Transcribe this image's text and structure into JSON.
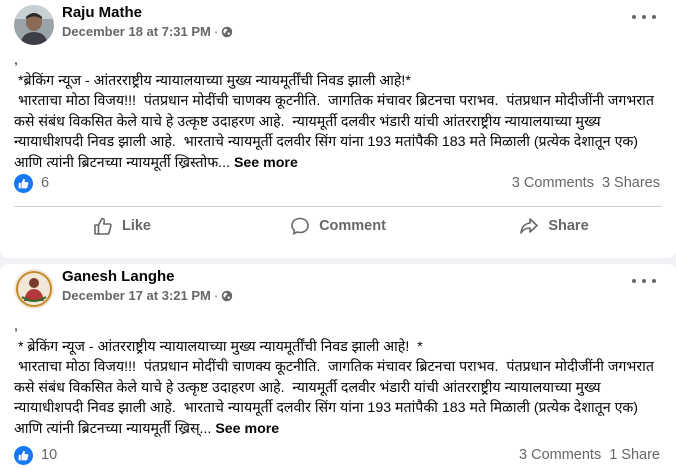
{
  "post1": {
    "author": "Raju Mathe",
    "timestamp": "December 18 at 7:31 PM",
    "separator": "·",
    "lead": ",",
    "text": " *ब्रेकिंग न्यूज - आंतरराष्ट्रीय न्यायालयाच्या मुख्य न्यायमूर्तींची निवड झाली आहे!*\n भारताचा मोठा विजय!!!  पंतप्रधान मोदींची चाणक्य कूटनीति.  जागतिक मंचावर ब्रिटनचा पराभव.  पंतप्रधान मोदीजींनी जगभरात कसे संबंध विकसित केले याचे हे उत्कृष्ट उदाहरण आहे.  न्यायमूर्ती दलवीर भंडारी यांची आंतरराष्ट्रीय न्यायालयाच्या मुख्य न्यायाधीशपदी निवड झाली आहे.  भारताचे न्यायमूर्ती दलवीर सिंग यांना 193 मतांपैकी 183 मते मिळाली (प्रत्येक देशातून एक) आणि त्यांनी ब्रिटनच्या न्यायमूर्ती ख्रिस्तोफ...",
    "see_more": "See more",
    "likes": "6",
    "comments": "3 Comments",
    "shares": "3 Shares",
    "actions": {
      "like": "Like",
      "comment": "Comment",
      "share": "Share"
    }
  },
  "post2": {
    "author": "Ganesh Langhe",
    "timestamp": "December 17 at 3:21 PM",
    "separator": "·",
    "lead": ",",
    "text": " * ब्रेकिंग न्यूज - आंतरराष्ट्रीय न्यायालयाच्या मुख्य न्यायमूर्तींची निवड झाली आहे!  *\n भारताचा मोठा विजय!!!  पंतप्रधान मोदींची चाणक्य कूटनीति.  जागतिक मंचावर ब्रिटनचा पराभव.  पंतप्रधान मोदीजींनी जगभरात कसे संबंध विकसित केले याचे हे उत्कृष्ट उदाहरण आहे.  न्यायमूर्ती दलवीर भंडारी यांची आंतरराष्ट्रीय न्यायालयाच्या मुख्य न्यायाधीशपदी निवड झाली आहे.  भारताचे न्यायमूर्ती दलवीर सिंग यांना 193 मतांपैकी 183 मते मिळाली (प्रत्येक देशातून एक) आणि त्यांनी ब्रिटनच्या न्यायमूर्ती ख्रिस्...",
    "see_more": "See more",
    "likes": "10",
    "comments": "3 Comments",
    "shares": "1 Share"
  },
  "colors": {
    "accent": "#1877f2",
    "secondary_text": "#65676b",
    "background": "#f0f2f5"
  },
  "icons": {
    "like_badge": "thumbs-up-icon",
    "privacy": "globe-icon",
    "menu": "more-dots-icon"
  }
}
